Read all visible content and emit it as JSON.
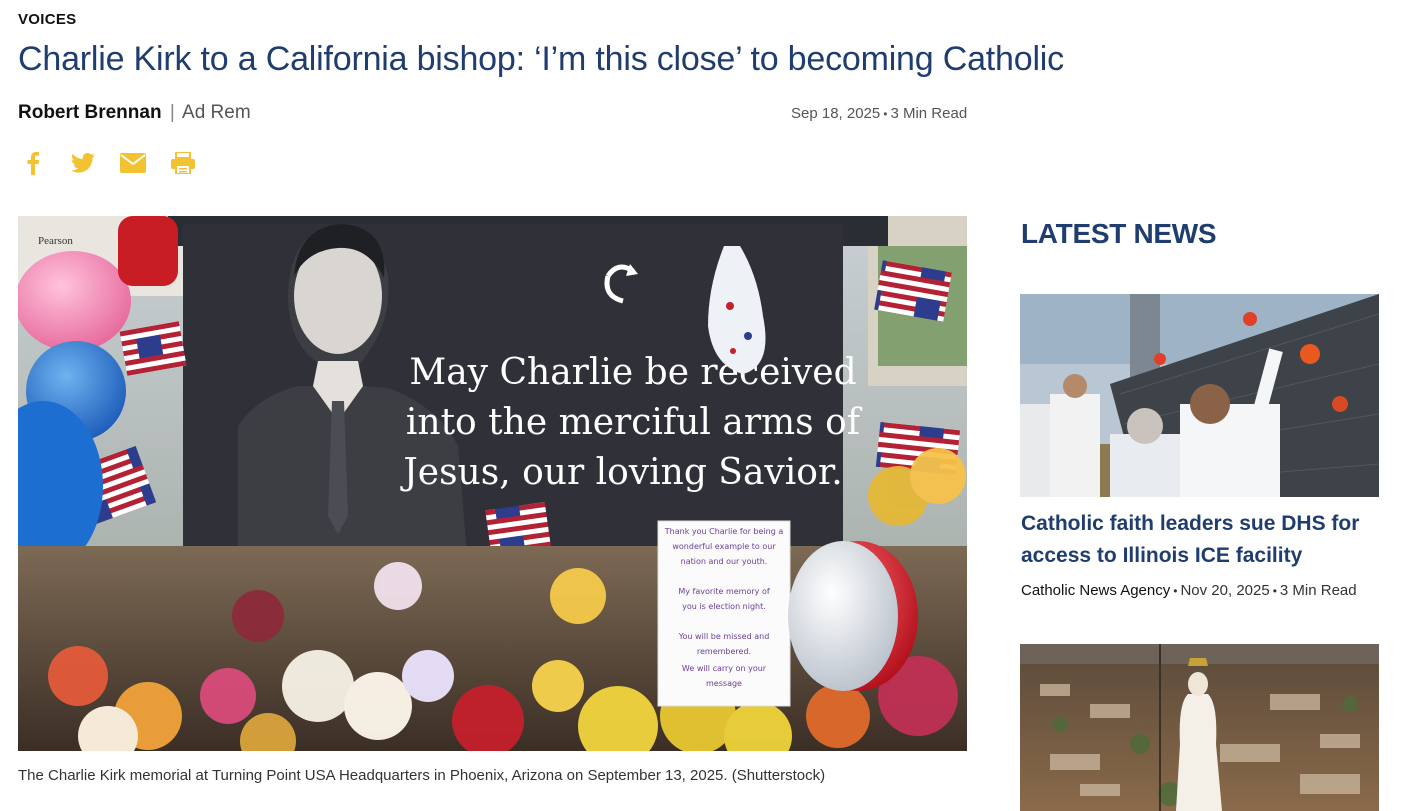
{
  "article": {
    "section": "VOICES",
    "headline": "Charlie Kirk to a California bishop: ‘I’m this close’ to becoming Catholic",
    "author": "Robert Brennan",
    "separator": "|",
    "column": "Ad Rem",
    "date": "Sep 18, 2025",
    "read_time": "3 Min Read",
    "share_icons": [
      "facebook-icon",
      "twitter-icon",
      "email-icon",
      "print-icon"
    ],
    "image": {
      "sign_text": [
        "May Charlie be received",
        "into the merciful arms of",
        "Jesus, our loving Savior."
      ],
      "note_text": [
        "Thank you Charlie for being a",
        "wonderful example to our",
        "nation and our youth.",
        "My favorite memory of",
        "you is election night.",
        "You will be missed and",
        "remembered.",
        "We will carry on your",
        "message"
      ],
      "sign_corner": "Pearson"
    },
    "caption": "The Charlie Kirk memorial at Turning Point USA Headquarters in Phoenix, Arizona on September 13, 2025. (Shutterstock)"
  },
  "sidebar": {
    "title": "LATEST NEWS",
    "items": [
      {
        "title": "Catholic faith leaders sue DHS for access to Illinois ICE facility",
        "source": "Catholic News Agency",
        "date": "Nov 20, 2025",
        "read_time": "3 Min Read"
      }
    ]
  },
  "colors": {
    "headline": "#1f3d6e",
    "share_icon": "#f2c230",
    "text": "#111111"
  }
}
